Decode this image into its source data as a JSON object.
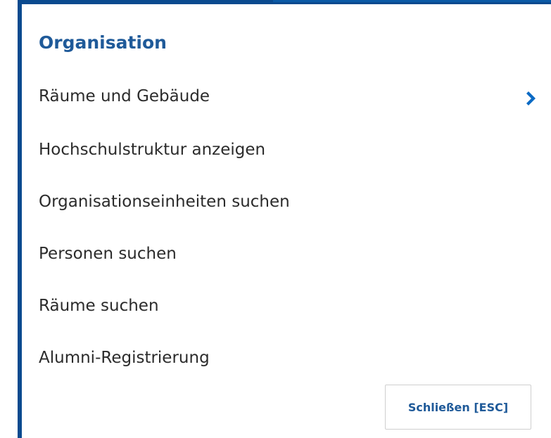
{
  "menu": {
    "title": "Organisation",
    "items": [
      {
        "label": "Räume und Gebäude",
        "has_submenu": true,
        "icon": "chevron-right-icon"
      },
      {
        "label": "Hochschulstruktur anzeigen",
        "has_submenu": false
      },
      {
        "label": "Organisationseinheiten suchen",
        "has_submenu": false
      },
      {
        "label": "Personen suchen",
        "has_submenu": false
      },
      {
        "label": "Räume suchen",
        "has_submenu": false
      },
      {
        "label": "Alumni-Registrierung",
        "has_submenu": false
      }
    ],
    "close_label": "Schließen [ESC]"
  },
  "colors": {
    "frame": "#0a4a8f",
    "title": "#1f5a99",
    "text": "#2b2b2b",
    "chevron": "#0b6ac4"
  }
}
